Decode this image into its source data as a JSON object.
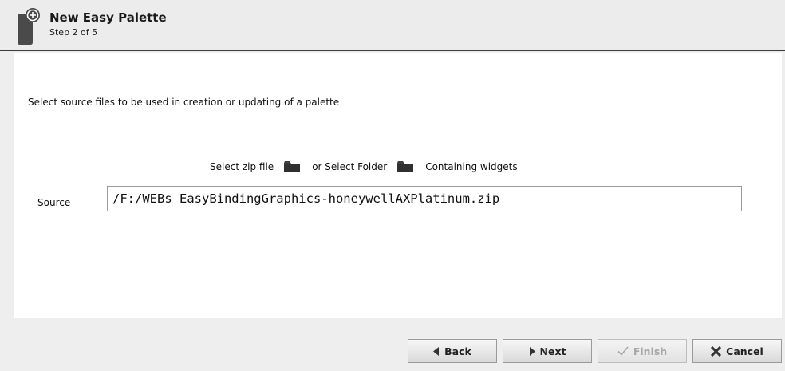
{
  "header": {
    "title": "New Easy Palette",
    "subtitle": "Step 2 of 5",
    "icon": "palette-add-icon"
  },
  "content": {
    "instruction": "Select source files to be used in creation or updating of a palette",
    "picker": {
      "zip_label": "Select zip file",
      "zip_icon": "folder-icon",
      "folder_label": "or Select Folder",
      "folder_icon": "folder-icon",
      "widgets_label": "Containing widgets"
    },
    "source": {
      "label": "Source",
      "value": "/F:/WEBs EasyBindingGraphics-honeywellAXPlatinum.zip"
    }
  },
  "footer": {
    "back_label": "Back",
    "next_label": "Next",
    "finish_label": "Finish",
    "cancel_label": "Cancel",
    "finish_enabled": false
  },
  "colors": {
    "header_bg": "#ececec",
    "content_bg": "#ffffff",
    "window_bg": "#eeeeee",
    "disabled_text": "#a8a8a8"
  }
}
